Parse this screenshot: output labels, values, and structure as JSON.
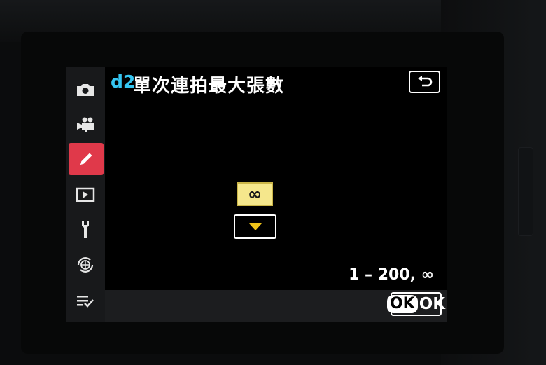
{
  "menu": {
    "tabs": [
      {
        "icon": "camera-icon",
        "active": false
      },
      {
        "icon": "movie-camera-icon",
        "active": false
      },
      {
        "icon": "pencil-icon",
        "active": true
      },
      {
        "icon": "playback-icon",
        "active": false
      },
      {
        "icon": "wrench-icon",
        "active": false
      },
      {
        "icon": "network-icon",
        "active": false
      },
      {
        "icon": "my-menu-icon",
        "active": false
      }
    ]
  },
  "header": {
    "code": "d2",
    "title": "單次連拍最大張數",
    "back_icon": "return-icon"
  },
  "setting": {
    "current_value": "∞",
    "range_text": "1 – 200, ∞"
  },
  "footer": {
    "ok_badge": "OK",
    "ok_label": "OK"
  },
  "colors": {
    "accent_active": "#e0394a",
    "title_code": "#35c6f2",
    "value_highlight": "#f5e78c",
    "arrow": "#f0c419"
  }
}
